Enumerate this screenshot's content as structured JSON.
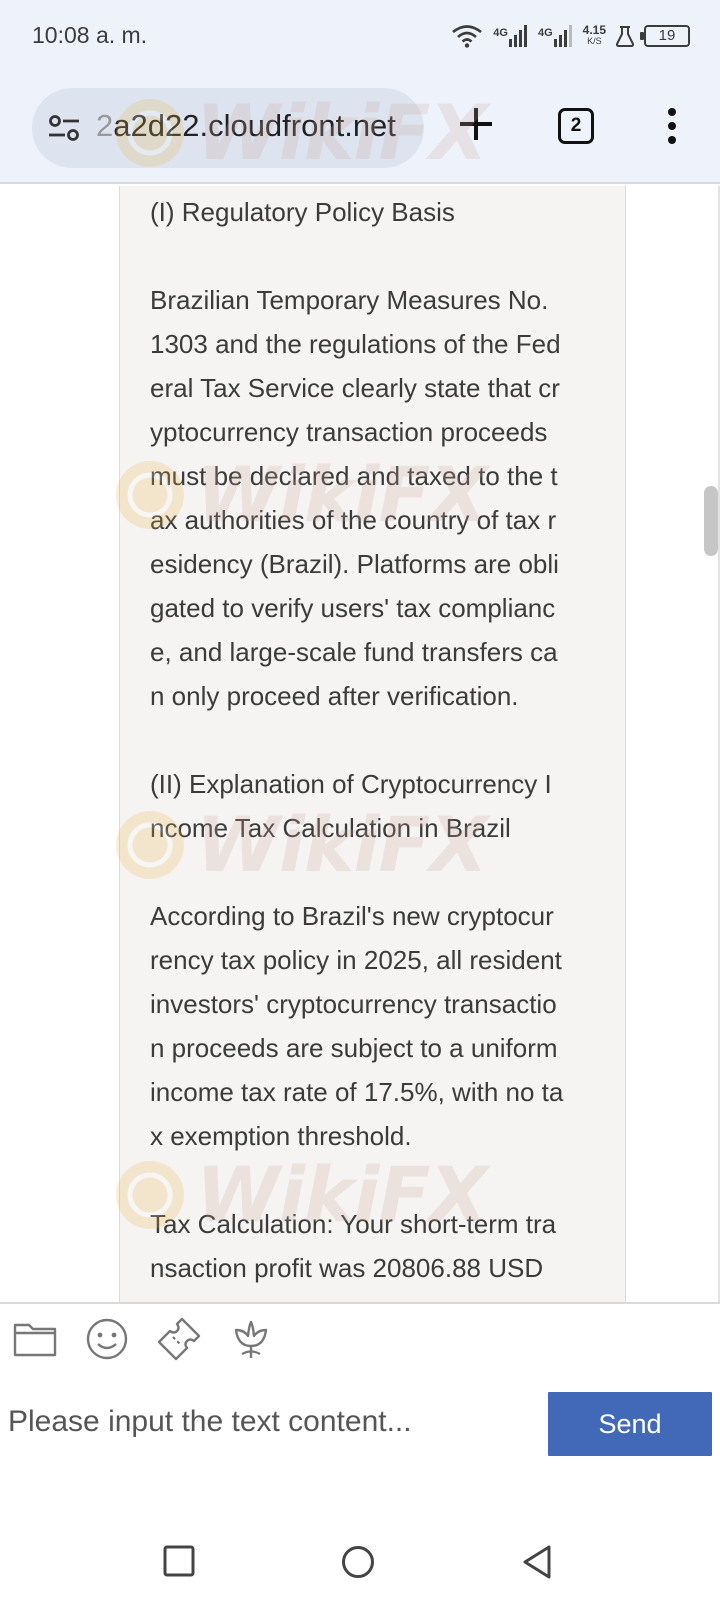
{
  "status_bar": {
    "time": "10:08 a. m.",
    "net1": "4G",
    "net2": "4G",
    "speed_value": "4.15",
    "speed_unit": "K/S",
    "battery": "19"
  },
  "browser": {
    "url_faded": "2",
    "url": "a2d22.cloudfront.net",
    "tab_count": "2"
  },
  "article": {
    "paragraphs": [
      "(I) Regulatory Policy Basis",
      "Brazilian Temporary Measures No.\n1303 and the regulations of the Fed\neral Tax Service clearly state that cr\nyptocurrency transaction proceeds\nmust be declared and taxed to the t\nax authorities of the country of tax r\nesidency (Brazil). Platforms are obli\ngated to verify users' tax complianc\ne, and large-scale fund transfers ca\nn only proceed after verification.",
      "(II) Explanation of Cryptocurrency I\nncome Tax Calculation in Brazil",
      "According to Brazil's new cryptocur\nrency tax policy in 2025, all resident\ninvestors' cryptocurrency transactio\nn proceeds are subject to a uniform\nincome tax rate of 17.5%, with no ta\nx exemption threshold.",
      "Tax Calculation: Your short-term tra\nnsaction profit was 20806.88 USD"
    ]
  },
  "watermark": {
    "text": "WikiFX"
  },
  "composer": {
    "placeholder": "Please input the text content...",
    "send_label": "Send"
  }
}
